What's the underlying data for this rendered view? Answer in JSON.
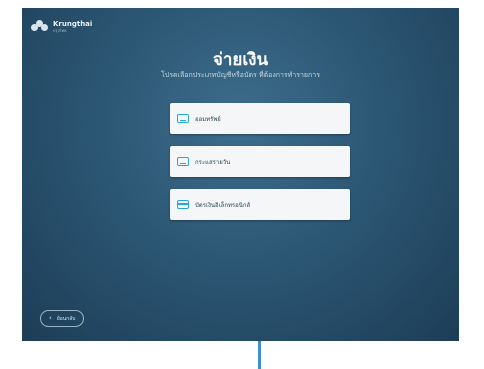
{
  "brand": {
    "name": "Krungthai",
    "sub": "กรุงไทย"
  },
  "page": {
    "title": "จ่ายเงิน",
    "subtitle": "โปรดเลือกประเภทบัญชีหรือบัตร ที่ต้องการทำรายการ"
  },
  "options": [
    {
      "label": "ออมทรัพย์",
      "icon": "account-icon"
    },
    {
      "label": "กระแสรายวัน",
      "icon": "account-icon"
    },
    {
      "label": "บัตรเงินอิเล็กทรอนิกส์",
      "icon": "card-icon"
    }
  ],
  "back": {
    "label": "ย้อนกลับ"
  },
  "colors": {
    "accent": "#2aa6d6",
    "background": "#2c5774",
    "connector": "#3d8fd6"
  }
}
